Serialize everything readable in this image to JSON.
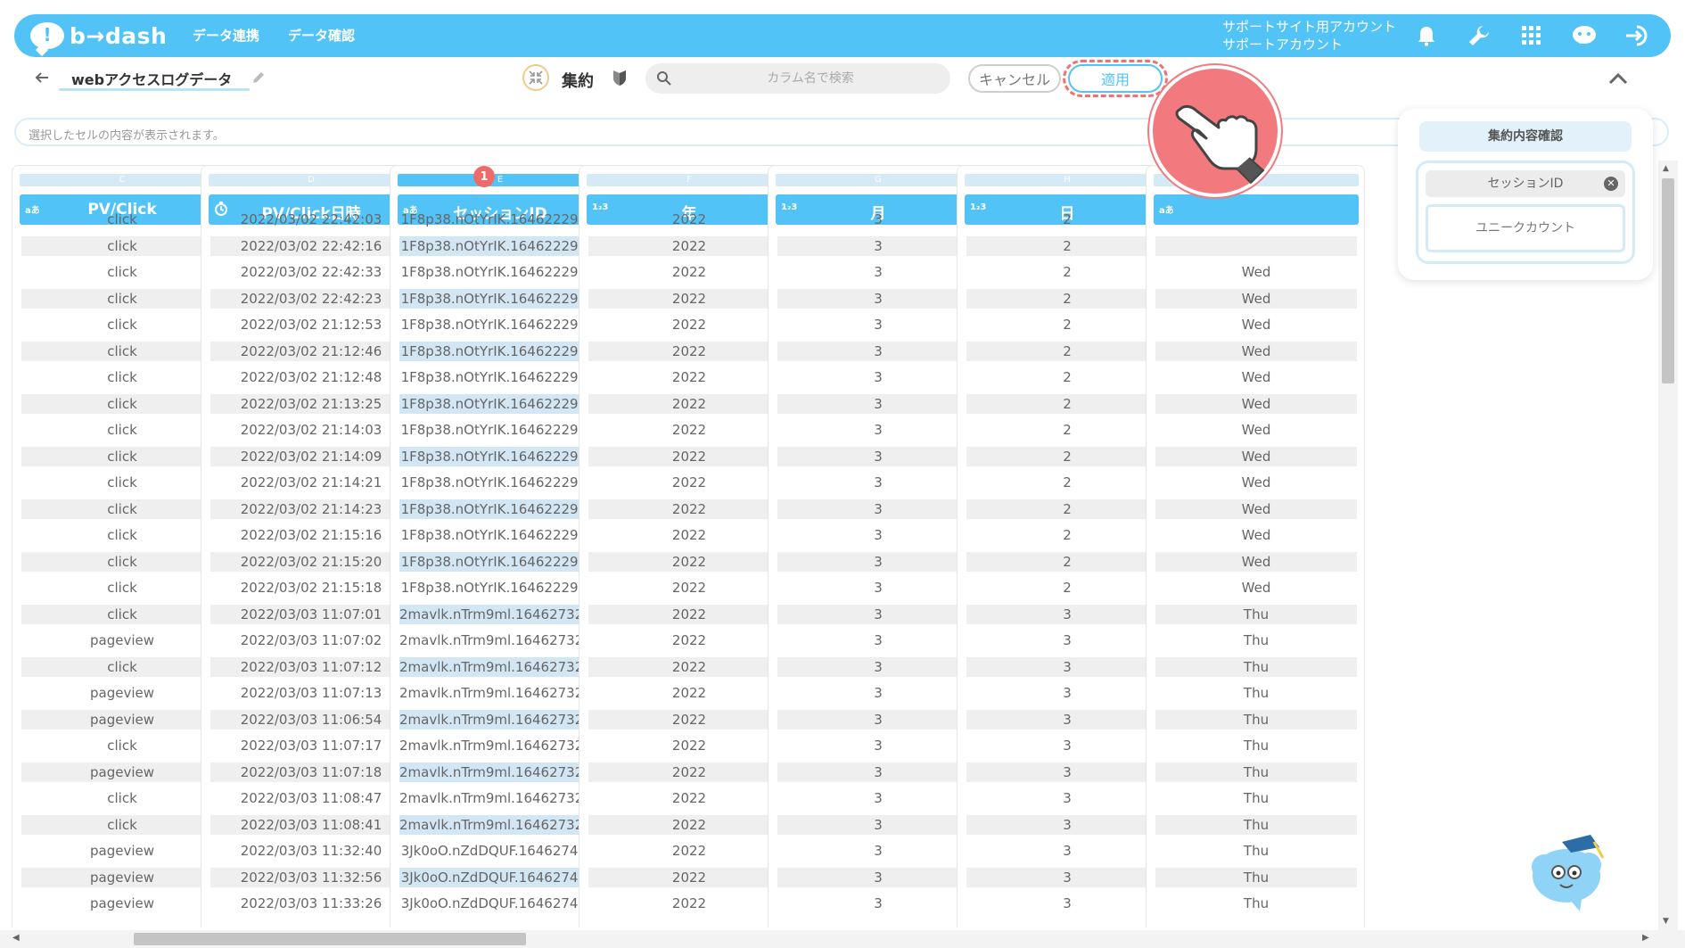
{
  "header": {
    "logo_mark": "!",
    "logo_text": "b→dash",
    "nav": [
      "データ連携",
      "データ確認"
    ],
    "account_line1": "サポートサイト用アカウント",
    "account_line2": "サポートアカウント",
    "icons": [
      "bell-icon",
      "wrench-icon",
      "apps-grid-icon",
      "chat-bot-icon",
      "logout-icon"
    ]
  },
  "toolbar": {
    "dataset_name": "webアクセスログデータ",
    "aggregate_label": "集約",
    "search_placeholder": "カラム名で検索",
    "cancel_label": "キャンセル",
    "apply_label": "適用"
  },
  "cell_preview": {
    "placeholder": "選択したセルの内容が表示されます。"
  },
  "badge": "1",
  "columns": [
    {
      "letter": "C",
      "type": "aあ",
      "title": "PV/Click",
      "selected": false,
      "cells": [
        "click",
        "click",
        "click",
        "click",
        "click",
        "click",
        "click",
        "click",
        "click",
        "click",
        "click",
        "click",
        "click",
        "click",
        "click",
        "click",
        "pageview",
        "click",
        "pageview",
        "pageview",
        "click",
        "pageview",
        "click",
        "click",
        "pageview",
        "pageview",
        "pageview"
      ]
    },
    {
      "letter": "D",
      "type": "clock",
      "title": "PV/Click日時",
      "selected": false,
      "cells": [
        "2022/03/02 22:42:03",
        "2022/03/02 22:42:16",
        "2022/03/02 22:42:33",
        "2022/03/02 22:42:23",
        "2022/03/02 21:12:53",
        "2022/03/02 21:12:46",
        "2022/03/02 21:12:48",
        "2022/03/02 21:13:25",
        "2022/03/02 21:14:03",
        "2022/03/02 21:14:09",
        "2022/03/02 21:14:21",
        "2022/03/02 21:14:23",
        "2022/03/02 21:15:16",
        "2022/03/02 21:15:20",
        "2022/03/02 21:15:18",
        "2022/03/03 11:07:01",
        "2022/03/03 11:07:02",
        "2022/03/03 11:07:12",
        "2022/03/03 11:07:13",
        "2022/03/03 11:06:54",
        "2022/03/03 11:07:17",
        "2022/03/03 11:07:18",
        "2022/03/03 11:08:47",
        "2022/03/03 11:08:41",
        "2022/03/03 11:32:40",
        "2022/03/03 11:32:56",
        "2022/03/03 11:33:26"
      ]
    },
    {
      "letter": "E",
      "type": "aあ",
      "title": "セッションID",
      "selected": true,
      "cells": [
        "1F8p38.nOtYrIK.164622298...",
        "1F8p38.nOtYrIK.164622298...",
        "1F8p38.nOtYrIK.164622298...",
        "1F8p38.nOtYrIK.164622298...",
        "1F8p38.nOtYrIK.164622298...",
        "1F8p38.nOtYrIK.164622298...",
        "1F8p38.nOtYrIK.164622298...",
        "1F8p38.nOtYrIK.164622298...",
        "1F8p38.nOtYrIK.164622298...",
        "1F8p38.nOtYrIK.164622298...",
        "1F8p38.nOtYrIK.164622298...",
        "1F8p38.nOtYrIK.164622298...",
        "1F8p38.nOtYrIK.164622298...",
        "1F8p38.nOtYrIK.164622298...",
        "1F8p38.nOtYrIK.164622298...",
        "2mavlk.nTrm9ml.164627321...",
        "2mavlk.nTrm9ml.164627321...",
        "2mavlk.nTrm9ml.164627321...",
        "2mavlk.nTrm9ml.164627321...",
        "2mavlk.nTrm9ml.164627321...",
        "2mavlk.nTrm9ml.164627321...",
        "2mavlk.nTrm9ml.164627321...",
        "2mavlk.nTrm9ml.164627321...",
        "2mavlk.nTrm9ml.164627321...",
        "3Jk0oO.nZdDQUF.16462747...",
        "3Jk0oO.nZdDQUF.16462747...",
        "3Jk0oO.nZdDQUF.16462747..."
      ]
    },
    {
      "letter": "F",
      "type": "1₂3",
      "title": "年",
      "selected": false,
      "cells": [
        "2022",
        "2022",
        "2022",
        "2022",
        "2022",
        "2022",
        "2022",
        "2022",
        "2022",
        "2022",
        "2022",
        "2022",
        "2022",
        "2022",
        "2022",
        "2022",
        "2022",
        "2022",
        "2022",
        "2022",
        "2022",
        "2022",
        "2022",
        "2022",
        "2022",
        "2022",
        "2022"
      ]
    },
    {
      "letter": "G",
      "type": "1₂3",
      "title": "月",
      "selected": false,
      "cells": [
        "3",
        "3",
        "3",
        "3",
        "3",
        "3",
        "3",
        "3",
        "3",
        "3",
        "3",
        "3",
        "3",
        "3",
        "3",
        "3",
        "3",
        "3",
        "3",
        "3",
        "3",
        "3",
        "3",
        "3",
        "3",
        "3",
        "3"
      ]
    },
    {
      "letter": "H",
      "type": "1₂3",
      "title": "日",
      "selected": false,
      "cells": [
        "2",
        "2",
        "2",
        "2",
        "2",
        "2",
        "2",
        "2",
        "2",
        "2",
        "2",
        "2",
        "2",
        "2",
        "2",
        "3",
        "3",
        "3",
        "3",
        "3",
        "3",
        "3",
        "3",
        "3",
        "3",
        "3",
        "3"
      ]
    },
    {
      "letter": "I",
      "type": "aあ",
      "title": "",
      "selected": false,
      "cells": [
        "",
        "",
        "Wed",
        "Wed",
        "Wed",
        "Wed",
        "Wed",
        "Wed",
        "Wed",
        "Wed",
        "Wed",
        "Wed",
        "Wed",
        "Wed",
        "Wed",
        "Thu",
        "Thu",
        "Thu",
        "Thu",
        "Thu",
        "Thu",
        "Thu",
        "Thu",
        "Thu",
        "Thu",
        "Thu",
        "Thu"
      ]
    }
  ],
  "agg_panel": {
    "title": "集約内容確認",
    "key": "セッションID",
    "method": "ユニークカウント"
  }
}
